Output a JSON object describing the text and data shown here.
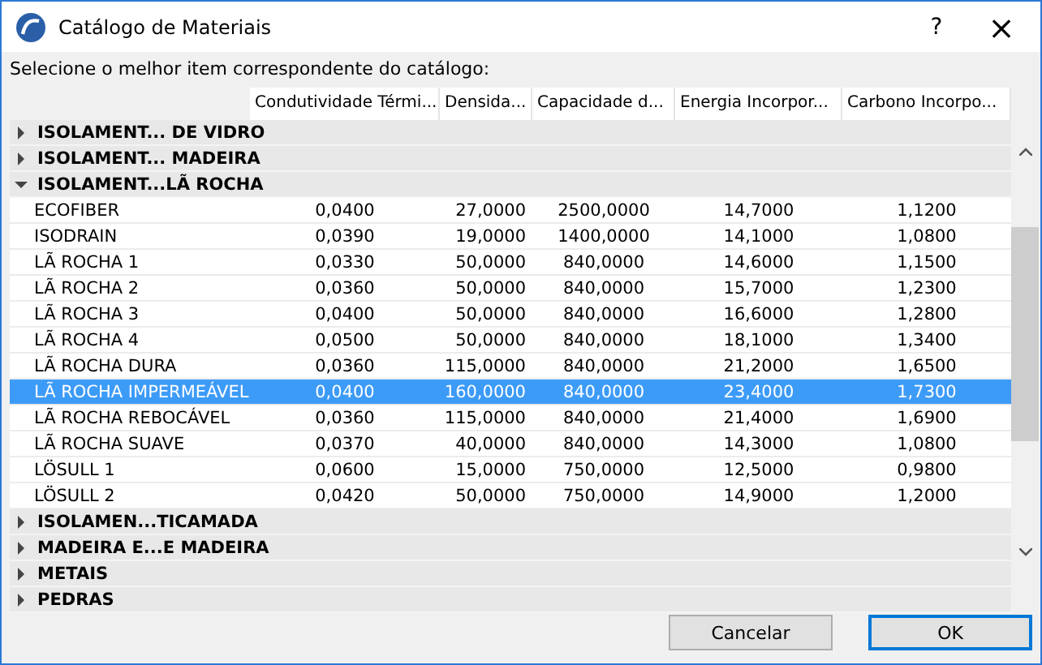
{
  "window": {
    "title": "Catálogo de Materiais",
    "help": "?",
    "close": "×"
  },
  "instruction": "Selecione o melhor item correspondente do catálogo:",
  "columns": [
    "",
    "Condutividade Térmi...",
    "Densida...",
    "Capacidade d...",
    "Energia Incorpor...",
    "Carbono Incorpo..."
  ],
  "groups": [
    {
      "name": "ISOLAMENT... DE VIDRO",
      "expanded": false
    },
    {
      "name": "ISOLAMENT... MADEIRA",
      "expanded": false
    },
    {
      "name": "ISOLAMENT...LÃ ROCHA",
      "expanded": true,
      "items": [
        {
          "name": "ECOFIBER",
          "cells": [
            "0,0400",
            "27,0000",
            "2500,0000",
            "14,7000",
            "1,1200"
          ],
          "selected": false
        },
        {
          "name": "ISODRAIN",
          "cells": [
            "0,0390",
            "19,0000",
            "1400,0000",
            "14,1000",
            "1,0800"
          ],
          "selected": false
        },
        {
          "name": "LÃ ROCHA 1",
          "cells": [
            "0,0330",
            "50,0000",
            "840,0000",
            "14,6000",
            "1,1500"
          ],
          "selected": false
        },
        {
          "name": "LÃ ROCHA 2",
          "cells": [
            "0,0360",
            "50,0000",
            "840,0000",
            "15,7000",
            "1,2300"
          ],
          "selected": false
        },
        {
          "name": "LÃ ROCHA 3",
          "cells": [
            "0,0400",
            "50,0000",
            "840,0000",
            "16,6000",
            "1,2800"
          ],
          "selected": false
        },
        {
          "name": "LÃ ROCHA 4",
          "cells": [
            "0,0500",
            "50,0000",
            "840,0000",
            "18,1000",
            "1,3400"
          ],
          "selected": false
        },
        {
          "name": "LÃ ROCHA DURA",
          "cells": [
            "0,0360",
            "115,0000",
            "840,0000",
            "21,2000",
            "1,6500"
          ],
          "selected": false
        },
        {
          "name": "LÃ ROCHA IMPERMEÁVEL",
          "cells": [
            "0,0400",
            "160,0000",
            "840,0000",
            "23,4000",
            "1,7300"
          ],
          "selected": true
        },
        {
          "name": "LÃ ROCHA REBOCÁVEL",
          "cells": [
            "0,0360",
            "115,0000",
            "840,0000",
            "21,4000",
            "1,6900"
          ],
          "selected": false
        },
        {
          "name": "LÃ ROCHA SUAVE",
          "cells": [
            "0,0370",
            "40,0000",
            "840,0000",
            "14,3000",
            "1,0800"
          ],
          "selected": false
        },
        {
          "name": "LÖSULL 1",
          "cells": [
            "0,0600",
            "15,0000",
            "750,0000",
            "12,5000",
            "0,9800"
          ],
          "selected": false
        },
        {
          "name": "LÖSULL 2",
          "cells": [
            "0,0420",
            "50,0000",
            "750,0000",
            "14,9000",
            "1,2000"
          ],
          "selected": false
        }
      ]
    },
    {
      "name": "ISOLAMEN...TICAMADA",
      "expanded": false
    },
    {
      "name": "MADEIRA E...E MADEIRA",
      "expanded": false
    },
    {
      "name": "METAIS",
      "expanded": false
    },
    {
      "name": "PEDRAS",
      "expanded": false
    }
  ],
  "buttons": [
    {
      "label": "Cancelar",
      "default": false
    },
    {
      "label": "OK",
      "default": true
    }
  ]
}
